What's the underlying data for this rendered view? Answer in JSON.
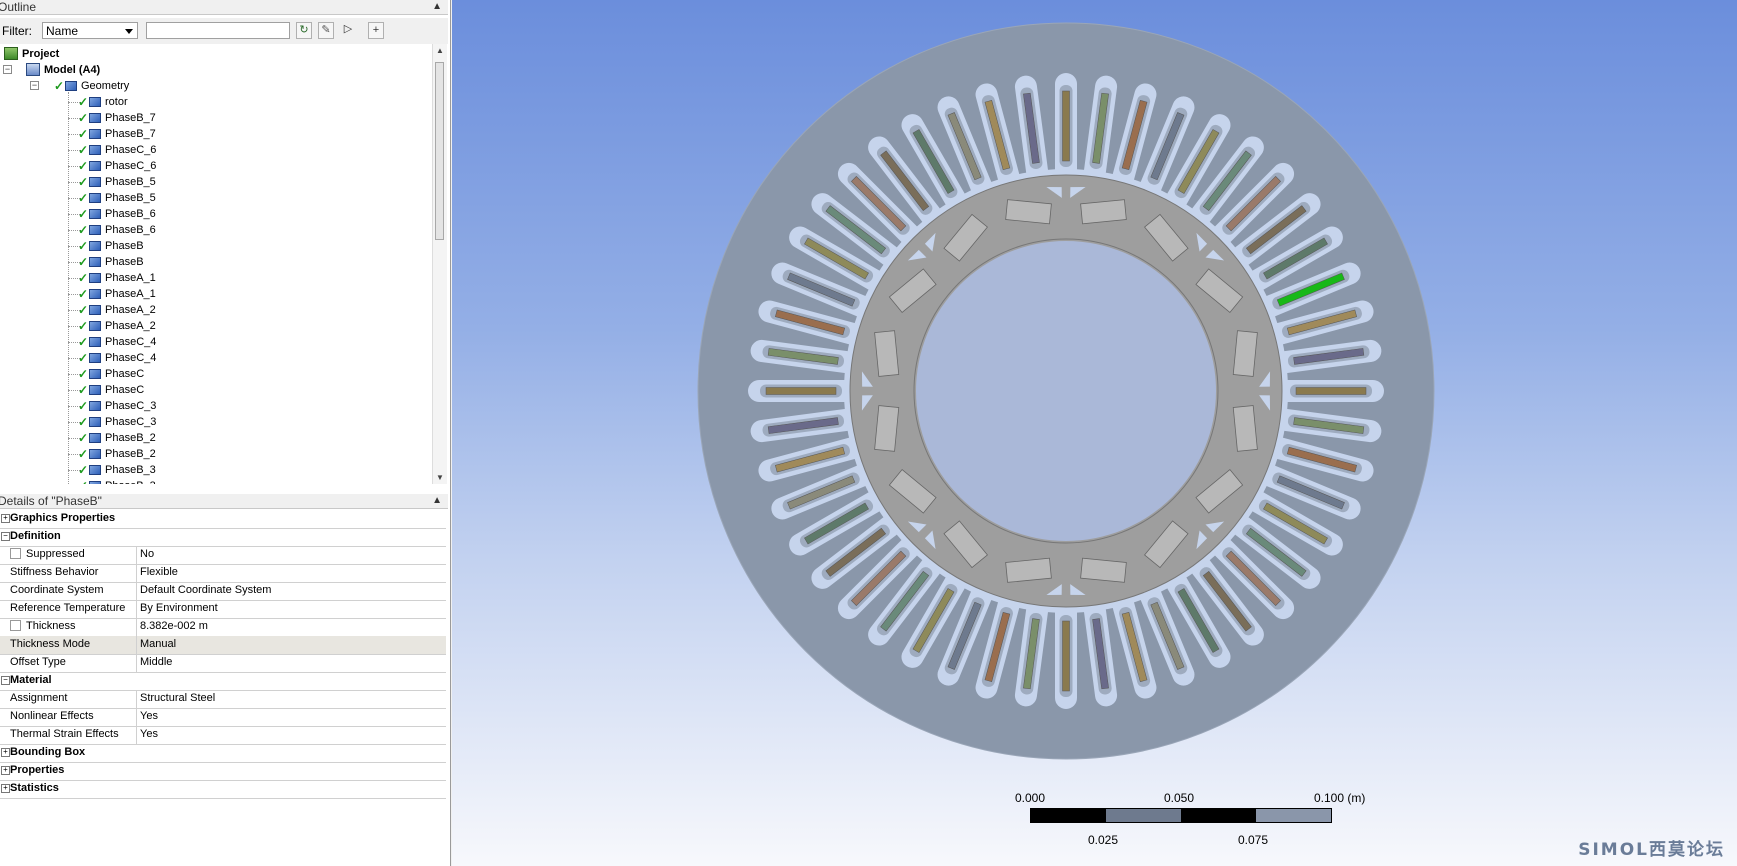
{
  "outline": {
    "title": "Outline",
    "filter_label": "Filter:",
    "filter_value": "Name",
    "tree": [
      {
        "label": "Project",
        "level": 0,
        "type": "project",
        "bold": true
      },
      {
        "label": "Model (A4)",
        "level": 1,
        "type": "model",
        "bold": true
      },
      {
        "label": "Geometry",
        "level": 2,
        "type": "geometry"
      },
      {
        "label": "rotor",
        "level": 3,
        "type": "body"
      },
      {
        "label": "PhaseB_7",
        "level": 3,
        "type": "body"
      },
      {
        "label": "PhaseB_7",
        "level": 3,
        "type": "body"
      },
      {
        "label": "PhaseC_6",
        "level": 3,
        "type": "body"
      },
      {
        "label": "PhaseC_6",
        "level": 3,
        "type": "body"
      },
      {
        "label": "PhaseB_5",
        "level": 3,
        "type": "body"
      },
      {
        "label": "PhaseB_5",
        "level": 3,
        "type": "body"
      },
      {
        "label": "PhaseB_6",
        "level": 3,
        "type": "body"
      },
      {
        "label": "PhaseB_6",
        "level": 3,
        "type": "body"
      },
      {
        "label": "PhaseB",
        "level": 3,
        "type": "body"
      },
      {
        "label": "PhaseB",
        "level": 3,
        "type": "body"
      },
      {
        "label": "PhaseA_1",
        "level": 3,
        "type": "body"
      },
      {
        "label": "PhaseA_1",
        "level": 3,
        "type": "body"
      },
      {
        "label": "PhaseA_2",
        "level": 3,
        "type": "body"
      },
      {
        "label": "PhaseA_2",
        "level": 3,
        "type": "body"
      },
      {
        "label": "PhaseC_4",
        "level": 3,
        "type": "body"
      },
      {
        "label": "PhaseC_4",
        "level": 3,
        "type": "body"
      },
      {
        "label": "PhaseC",
        "level": 3,
        "type": "body"
      },
      {
        "label": "PhaseC",
        "level": 3,
        "type": "body"
      },
      {
        "label": "PhaseC_3",
        "level": 3,
        "type": "body"
      },
      {
        "label": "PhaseC_3",
        "level": 3,
        "type": "body"
      },
      {
        "label": "PhaseB_2",
        "level": 3,
        "type": "body"
      },
      {
        "label": "PhaseB_2",
        "level": 3,
        "type": "body"
      },
      {
        "label": "PhaseB_3",
        "level": 3,
        "type": "body"
      },
      {
        "label": "PhaseB_3",
        "level": 3,
        "type": "body"
      }
    ]
  },
  "details": {
    "title": "Details of \"PhaseB\"",
    "rows": [
      {
        "kind": "category",
        "label": "Graphics Properties",
        "expanded": false
      },
      {
        "kind": "category",
        "label": "Definition",
        "expanded": true
      },
      {
        "kind": "prop",
        "label": "Suppressed",
        "value": "No",
        "checkbox": true
      },
      {
        "kind": "prop",
        "label": "Stiffness Behavior",
        "value": "Flexible"
      },
      {
        "kind": "prop",
        "label": "Coordinate System",
        "value": "Default Coordinate System"
      },
      {
        "kind": "prop",
        "label": "Reference Temperature",
        "value": "By Environment"
      },
      {
        "kind": "prop",
        "label": "Thickness",
        "value": "8.382e-002 m",
        "checkbox": true
      },
      {
        "kind": "prop",
        "label": "Thickness Mode",
        "value": "Manual",
        "highlight": true
      },
      {
        "kind": "prop",
        "label": "Offset Type",
        "value": "Middle"
      },
      {
        "kind": "category",
        "label": "Material",
        "expanded": true
      },
      {
        "kind": "prop",
        "label": "Assignment",
        "value": "Structural Steel"
      },
      {
        "kind": "prop",
        "label": "Nonlinear Effects",
        "value": "Yes"
      },
      {
        "kind": "prop",
        "label": "Thermal Strain Effects",
        "value": "Yes"
      },
      {
        "kind": "category",
        "label": "Bounding Box",
        "expanded": false
      },
      {
        "kind": "category",
        "label": "Properties",
        "expanded": false
      },
      {
        "kind": "category",
        "label": "Statistics",
        "expanded": false
      }
    ]
  },
  "viewport": {
    "slot_count": 48,
    "highlighted_slot": "PhaseB",
    "colors": {
      "stator": "#8a97aa",
      "slot": "#c6d4ec",
      "rotor": "#9e9e9e",
      "highlight": "#18b818"
    },
    "conductor_colors": [
      "#8a7a4e",
      "#7a8f6a",
      "#9a6e4e",
      "#6e7a8e",
      "#8e8a5a",
      "#6a8a7a",
      "#9a7a6a",
      "#7a6e5a",
      "#5e7a6a",
      "#8a8a7a",
      "#a08a5a",
      "#6a6a8a"
    ],
    "scale": {
      "top_labels": [
        "0.000",
        "0.050",
        "0.100 (m)"
      ],
      "bottom_labels": [
        "0.025",
        "0.075"
      ]
    },
    "watermark": "SIMOL西莫论坛"
  }
}
